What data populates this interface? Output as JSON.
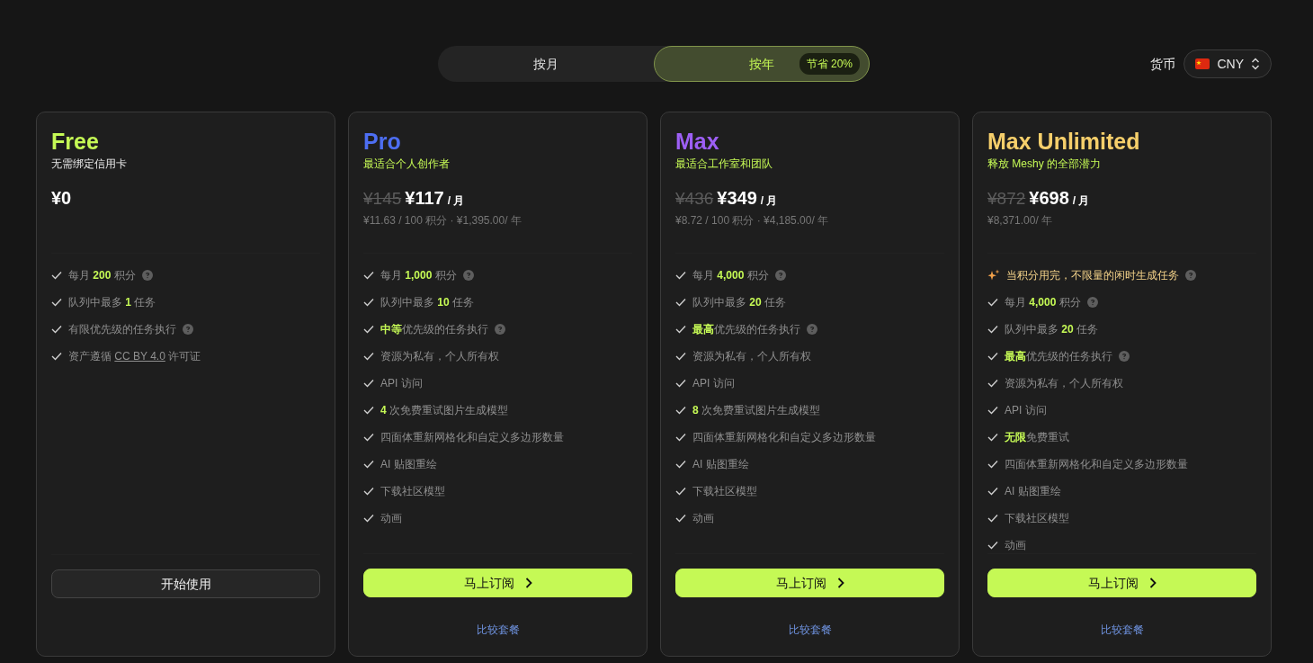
{
  "billing_toggle": {
    "options": [
      {
        "label": "按月",
        "selected": false
      },
      {
        "label": "按年",
        "selected": true,
        "badge": "节省 20%"
      }
    ]
  },
  "currency": {
    "label": "货币",
    "value": "CNY"
  },
  "plans": [
    {
      "kind": "free",
      "name": "Free",
      "color": "#c5f955",
      "tagline": "无需绑定信用卡",
      "price": "¥0",
      "features": [
        {
          "kind": "check",
          "text": "每月 **200** 积分",
          "help": true
        },
        {
          "kind": "check",
          "text": "队列中最多 **1** 任务",
          "help": false
        },
        {
          "kind": "check",
          "text": "有限优先级的任务执行",
          "help": true
        },
        {
          "kind": "check",
          "text": "资产遵循 ",
          "link": "CC BY 4.0",
          "after": " 许可证",
          "help": false
        }
      ],
      "button": "开始使用"
    },
    {
      "kind": "paid",
      "name": "Pro",
      "color": "#4d6ef2",
      "tagline": "最适合个人创作者",
      "old_price": "¥145",
      "price": "¥117",
      "per": "/ 月",
      "detail": "¥11.63 / 100 积分 · ¥1,395.00/ 年",
      "features": [
        {
          "kind": "check",
          "text": "每月 **1,000** 积分",
          "help": true
        },
        {
          "kind": "check",
          "text": "队列中最多 **10** 任务",
          "help": false
        },
        {
          "kind": "check",
          "text": "**中等**优先级的任务执行",
          "help": true
        },
        {
          "kind": "check",
          "text": "资源为私有，个人所有权",
          "help": false
        },
        {
          "kind": "check",
          "text": "API 访问",
          "help": false
        },
        {
          "kind": "check",
          "text": "**4** 次免费重试图片生成模型",
          "help": false
        },
        {
          "kind": "check",
          "text": "四面体重新网格化和自定义多边形数量",
          "help": false
        },
        {
          "kind": "check",
          "text": "AI 贴图重绘",
          "help": false
        },
        {
          "kind": "check",
          "text": "下载社区模型",
          "help": false
        },
        {
          "kind": "check",
          "text": "动画",
          "help": false
        }
      ],
      "button": "马上订阅",
      "compare": "比较套餐"
    },
    {
      "kind": "paid",
      "name": "Max",
      "color": "#9d5ff5",
      "tagline": "最适合工作室和团队",
      "old_price": "¥436",
      "price": "¥349",
      "per": "/ 月",
      "detail": "¥8.72 / 100 积分 · ¥4,185.00/ 年",
      "features": [
        {
          "kind": "check",
          "text": "每月 **4,000** 积分",
          "help": true
        },
        {
          "kind": "check",
          "text": "队列中最多 **20** 任务",
          "help": false
        },
        {
          "kind": "check",
          "text": "**最高**优先级的任务执行",
          "help": true
        },
        {
          "kind": "check",
          "text": "资源为私有，个人所有权",
          "help": false
        },
        {
          "kind": "check",
          "text": "API 访问",
          "help": false
        },
        {
          "kind": "check",
          "text": "**8** 次免费重试图片生成模型",
          "help": false
        },
        {
          "kind": "check",
          "text": "四面体重新网格化和自定义多边形数量",
          "help": false
        },
        {
          "kind": "check",
          "text": "AI 贴图重绘",
          "help": false
        },
        {
          "kind": "check",
          "text": "下载社区模型",
          "help": false
        },
        {
          "kind": "check",
          "text": "动画",
          "help": false
        }
      ],
      "button": "马上订阅",
      "compare": "比较套餐"
    },
    {
      "kind": "paid",
      "name": "Max Unlimited",
      "color": "#f6cf6b",
      "tagline": "释放 Meshy 的全部潜力",
      "old_price": "¥872",
      "price": "¥698",
      "per": "/ 月",
      "detail": "¥8,371.00/ 年",
      "features": [
        {
          "kind": "sparkle",
          "text": "当积分用完，不限量的闲时生成任务",
          "help": true
        },
        {
          "kind": "check",
          "text": "每月 **4,000** 积分",
          "help": true
        },
        {
          "kind": "check",
          "text": "队列中最多 **20** 任务",
          "help": false
        },
        {
          "kind": "check",
          "text": "**最高**优先级的任务执行",
          "help": true
        },
        {
          "kind": "check",
          "text": "资源为私有，个人所有权",
          "help": false
        },
        {
          "kind": "check",
          "text": "API 访问",
          "help": false
        },
        {
          "kind": "check",
          "text": "**无限**免费重试",
          "help": false
        },
        {
          "kind": "check",
          "text": "四面体重新网格化和自定义多边形数量",
          "help": false
        },
        {
          "kind": "check",
          "text": "AI 贴图重绘",
          "help": false
        },
        {
          "kind": "check",
          "text": "下载社区模型",
          "help": false
        },
        {
          "kind": "check",
          "text": "动画",
          "help": false
        }
      ],
      "button": "马上订阅",
      "compare": "比较套餐"
    }
  ]
}
